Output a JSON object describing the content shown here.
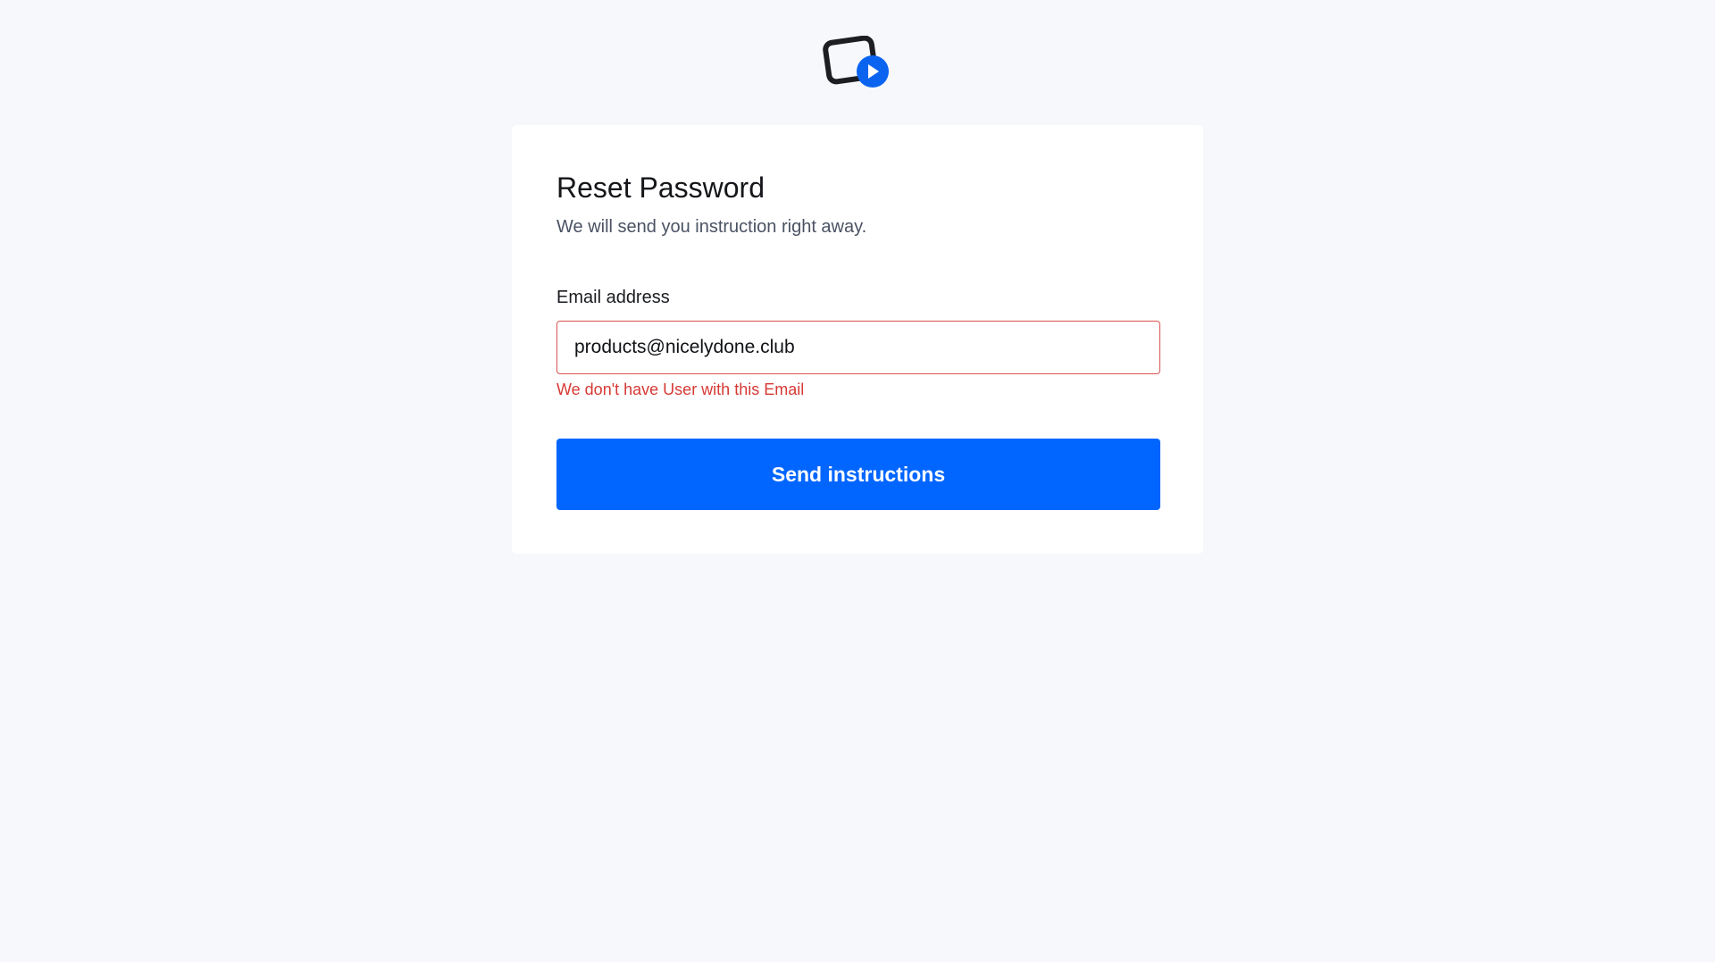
{
  "logo": {
    "icon": "video-card-icon",
    "colors": {
      "outline": "#1c1e22",
      "accent": "#0a64f0"
    }
  },
  "form": {
    "title": "Reset Password",
    "subtitle": "We will send you instruction right away.",
    "email_label": "Email address",
    "email_value": "products@nicelydone.club",
    "error_message": "We don't have User with this Email",
    "submit_label": "Send instructions"
  },
  "colors": {
    "background": "#f7f8fb",
    "card": "#ffffff",
    "primary": "#0066ff",
    "error": "#d63a35"
  }
}
